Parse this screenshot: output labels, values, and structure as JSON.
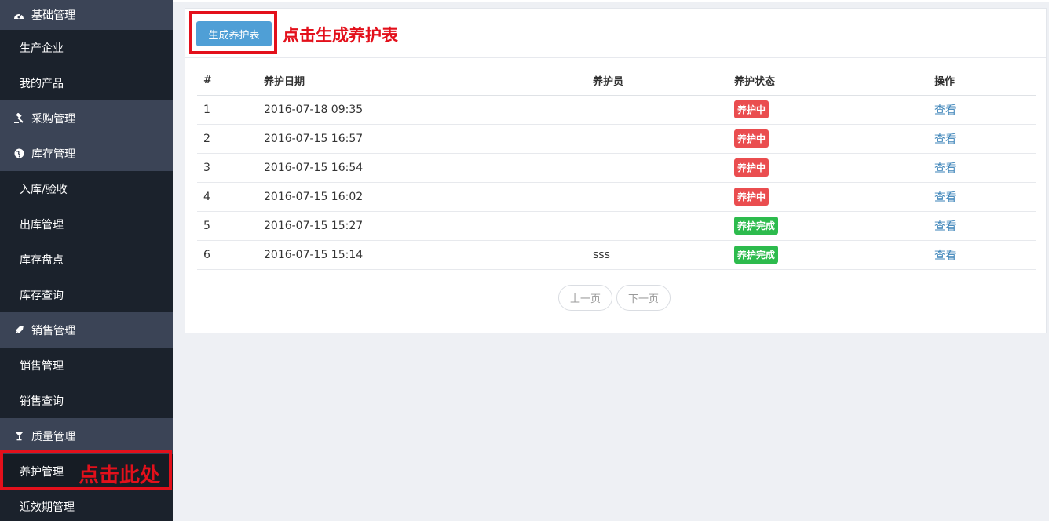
{
  "sidebar": {
    "sections": [
      {
        "label": "基础管理",
        "icon": "dashboard-icon",
        "items": [
          "生产企业",
          "我的产品"
        ]
      },
      {
        "label": "采购管理",
        "icon": "gavel-icon",
        "items": []
      },
      {
        "label": "库存管理",
        "icon": "globe-icon",
        "items": [
          "入库/验收",
          "出库管理",
          "库存盘点",
          "库存查询"
        ]
      },
      {
        "label": "销售管理",
        "icon": "rocket-icon",
        "items": [
          "销售管理",
          "销售查询"
        ]
      },
      {
        "label": "质量管理",
        "icon": "cocktail-icon",
        "items": [
          "养护管理",
          "近效期管理"
        ]
      }
    ]
  },
  "annotations": {
    "side": "点击此处",
    "top": "点击生成养护表"
  },
  "toolbar": {
    "generate_label": "生成养护表"
  },
  "table": {
    "headers": [
      "#",
      "养护日期",
      "养护员",
      "养护状态",
      "操作"
    ],
    "rows": [
      {
        "no": "1",
        "date": "2016-07-18 09:35",
        "staff": "",
        "status": "养护中",
        "status_color": "#ea4d4f",
        "action": "查看"
      },
      {
        "no": "2",
        "date": "2016-07-15 16:57",
        "staff": "",
        "status": "养护中",
        "status_color": "#ea4d4f",
        "action": "查看"
      },
      {
        "no": "3",
        "date": "2016-07-15 16:54",
        "staff": "",
        "status": "养护中",
        "status_color": "#ea4d4f",
        "action": "查看"
      },
      {
        "no": "4",
        "date": "2016-07-15 16:02",
        "staff": "",
        "status": "养护中",
        "status_color": "#ea4d4f",
        "action": "查看"
      },
      {
        "no": "5",
        "date": "2016-07-15 15:27",
        "staff": "",
        "status": "养护完成",
        "status_color": "#2dbb4d",
        "action": "查看"
      },
      {
        "no": "6",
        "date": "2016-07-15 15:14",
        "staff": "sss",
        "status": "养护完成",
        "status_color": "#2dbb4d",
        "action": "查看"
      }
    ]
  },
  "pager": {
    "prev": "上一页",
    "next": "下一页"
  }
}
